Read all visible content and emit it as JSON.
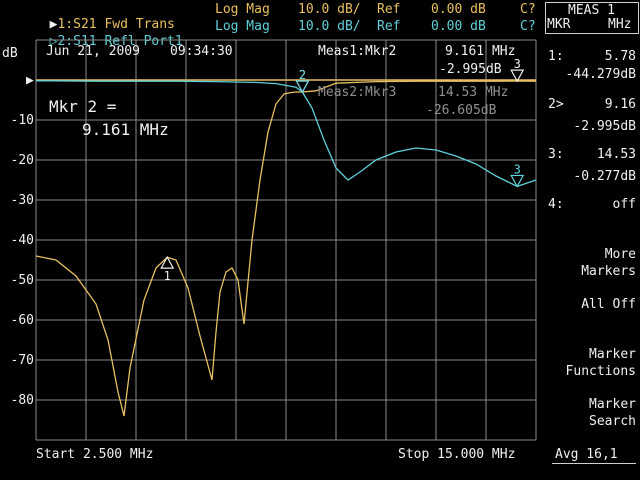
{
  "header": {
    "trace1": {
      "marker": "▶",
      "label": "1:S21 Fwd Trans",
      "format": "Log Mag",
      "scale": "10.0 dB/",
      "ref_label": "Ref",
      "ref_value": "0.00 dB",
      "cal": "C?"
    },
    "trace2": {
      "marker": "▷",
      "label": "2:S11 Refl Port1",
      "format": "Log Mag",
      "scale": "10.0 dB/",
      "ref_label": "Ref",
      "ref_value": "0.00 dB",
      "cal": "C?"
    }
  },
  "meas_box": {
    "title": "MEAS 1",
    "left": "MKR",
    "right": "MHz"
  },
  "plot": {
    "unit": "dB",
    "date": "Jun 21, 2009",
    "time": "09:34:30",
    "meas1": {
      "label": "Meas1:Mkr2",
      "freq": "9.161 MHz",
      "value": "-2.995dB"
    },
    "meas2": {
      "label": "Meas2:Mkr3",
      "freq": "14.53 MHz",
      "value": "-26.605dB"
    },
    "active_marker_label": "Mkr 2 =",
    "active_marker_value": "9.161 MHz",
    "start": "Start 2.500 MHz",
    "stop": "Stop 15.000 MHz",
    "y_ticks": [
      "-10",
      "-20",
      "-30",
      "-40",
      "-50",
      "-60",
      "-70",
      "-80"
    ]
  },
  "markers_list": [
    {
      "id": "1:",
      "freq": "5.78",
      "value": "-44.279dB"
    },
    {
      "id": "2>",
      "freq": "9.16",
      "value": "-2.995dB"
    },
    {
      "id": "3:",
      "freq": "14.53",
      "value": "-0.277dB"
    },
    {
      "id": "4:",
      "freq": "off",
      "value": ""
    }
  ],
  "softkeys": {
    "more_markers_1": "More",
    "more_markers_2": "Markers",
    "all_off_1": "All",
    "all_off_2": "Off",
    "marker_functions_1": "Marker",
    "marker_functions_2": "Functions",
    "marker_search_1": "Marker",
    "marker_search_2": "Search"
  },
  "status": {
    "avg": "Avg 16,1"
  },
  "chart_data": {
    "type": "line",
    "xlim": [
      2.5,
      15.0
    ],
    "ylim": [
      -90,
      10
    ],
    "grid": true,
    "series": [
      {
        "name": "1:S21 Fwd Trans",
        "color": "#e8c060",
        "x": [
          2.5,
          3.0,
          3.5,
          4.0,
          4.3,
          4.55,
          4.7,
          4.85,
          5.2,
          5.5,
          5.78,
          6.0,
          6.3,
          6.6,
          6.9,
          7.0,
          7.1,
          7.25,
          7.4,
          7.55,
          7.7,
          7.9,
          8.1,
          8.3,
          8.5,
          8.7,
          8.9,
          9.0,
          9.16,
          9.5,
          10.0,
          11.0,
          12.0,
          13.0,
          14.0,
          14.53,
          15.0
        ],
        "y": [
          -44,
          -45,
          -49,
          -56,
          -65,
          -78,
          -84,
          -72,
          -55,
          -47,
          -44.3,
          -45,
          -52,
          -64,
          -75,
          -63,
          -53,
          -48,
          -47,
          -50,
          -61,
          -40,
          -25,
          -13,
          -6,
          -3.5,
          -3.1,
          -3.0,
          -2.995,
          -2.7,
          -0.8,
          -0.4,
          -0.3,
          -0.3,
          -0.3,
          -0.277,
          -0.3
        ]
      },
      {
        "name": "2:S11 Refl Port1",
        "color": "#60d0d8",
        "x": [
          2.5,
          3.0,
          4.0,
          5.0,
          6.0,
          7.0,
          8.0,
          8.5,
          9.0,
          9.16,
          9.4,
          9.7,
          10.0,
          10.3,
          10.6,
          11.0,
          11.5,
          12.0,
          12.5,
          13.0,
          13.5,
          14.0,
          14.53,
          15.0
        ],
        "y": [
          -0.2,
          -0.2,
          -0.3,
          -0.3,
          -0.3,
          -0.4,
          -0.6,
          -0.9,
          -1.8,
          -3.0,
          -7,
          -15,
          -22,
          -25,
          -23,
          -20,
          -18,
          -17,
          -17.5,
          -19,
          -21,
          -24,
          -26.605,
          -25
        ]
      }
    ],
    "markers": [
      {
        "id": "1",
        "trace": 0,
        "x": 5.78,
        "y": -44.279
      },
      {
        "id": "2",
        "trace": 0,
        "x": 9.161,
        "y": -2.995
      },
      {
        "id": "2",
        "trace": 1,
        "x": 9.161,
        "y": -3.0
      },
      {
        "id": "3",
        "trace": 1,
        "x": 14.53,
        "y": -26.605
      },
      {
        "id": "3",
        "trace": 0,
        "x": 14.53,
        "y": -0.277
      }
    ]
  }
}
